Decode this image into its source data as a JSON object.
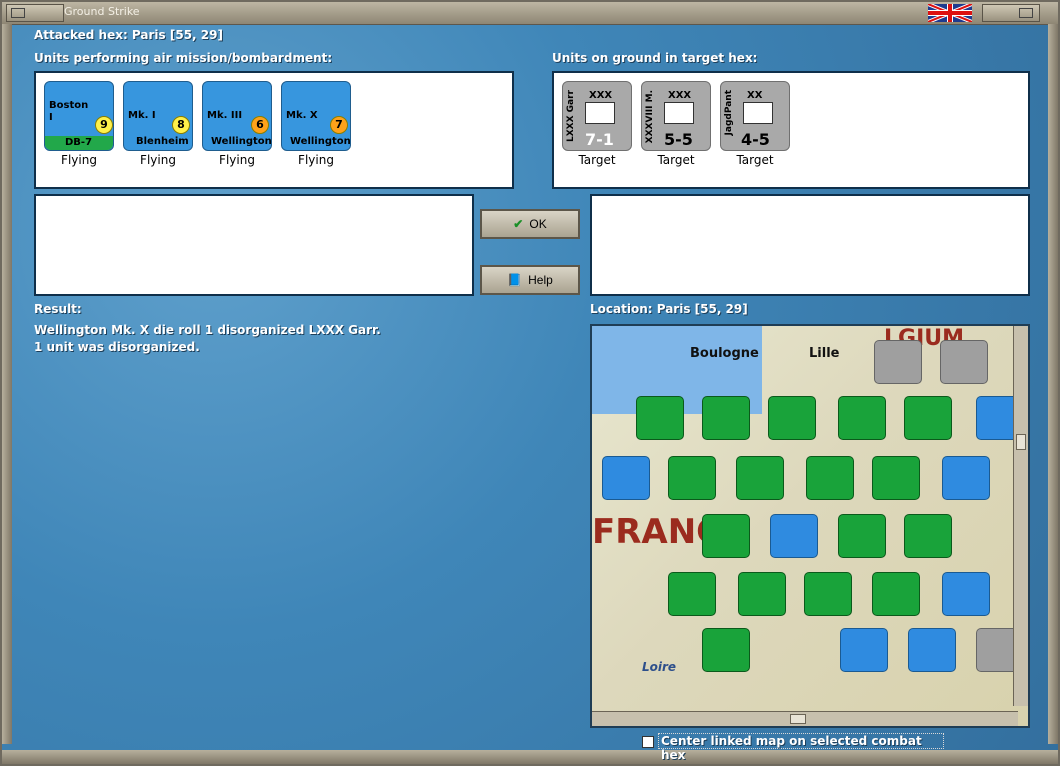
{
  "window": {
    "title": "Ground Strike"
  },
  "header": {
    "attacked_hex": "Attacked hex: Paris  [55, 29]"
  },
  "air_panel": {
    "label": "Units performing air mission/bombardment:",
    "units": [
      {
        "type": "Boston",
        "sub": "I",
        "code": "DB-7",
        "num": "9",
        "caption": "Flying"
      },
      {
        "type": "Mk. I",
        "sub": "Blenheim",
        "num": "8",
        "caption": "Flying"
      },
      {
        "type": "Mk. III",
        "sub": "Wellington",
        "num": "6",
        "caption": "Flying"
      },
      {
        "type": "Mk. X",
        "sub": "Wellington",
        "num": "7",
        "caption": "Flying"
      }
    ]
  },
  "ground_panel": {
    "label": "Units on ground in target hex:",
    "units": [
      {
        "title": "LXXX Garr",
        "xxx": "XXX",
        "value": "7-1",
        "caption": "Target"
      },
      {
        "title": "XXXVIII M.",
        "xxx": "XXX",
        "value": "5-5",
        "caption": "Target"
      },
      {
        "title": "JagdPant",
        "xxx": "XX",
        "value": "4-5",
        "caption": "Target"
      }
    ]
  },
  "buttons": {
    "ok": "OK",
    "help": "Help"
  },
  "result": {
    "label": "Result:",
    "line1": "Wellington Mk. X die roll 1 disorganized LXXX Garr.",
    "line2": "1 unit was disorganized."
  },
  "location": {
    "label": "Location:  Paris  [55, 29]"
  },
  "map": {
    "places": {
      "boulogne": "Boulogne",
      "lille": "Lille",
      "france": "FRANC",
      "loire": "Loire",
      "belgium": "LGIUM"
    }
  },
  "checkbox": {
    "label": "Center linked map on selected combat hex"
  },
  "colors": {
    "bg": "#3f86b8",
    "panel_border": "#0f2f4a",
    "air_counter": "#3796de",
    "ground_counter": "#a9a9a9",
    "map_green": "#19a33a"
  }
}
